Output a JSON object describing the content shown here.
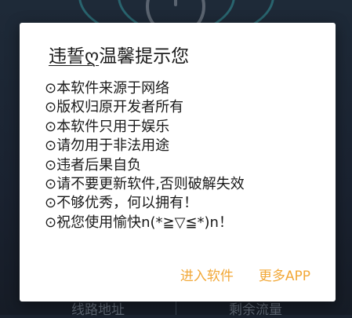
{
  "background": {
    "footer_labels": [
      "线路地址",
      "剩余流量"
    ]
  },
  "dialog": {
    "title_underlined": "违誓ღ",
    "title_rest": "温馨提示您",
    "messages": [
      "⊙本软件来源于网络",
      "⊙版权归原开发者所有",
      "⊙本软件只用于娱乐",
      "⊙请勿用于非法用途",
      "⊙违者后果自负",
      "⊙请不要更新软件,否则破解失效",
      "⊙不够优秀，何以拥有！",
      "⊙祝您使用愉快n(*≧▽≦*)n！"
    ],
    "actions": {
      "enter_label": "进入软件",
      "more_label": "更多APP"
    }
  },
  "colors": {
    "accent": "#f2a838",
    "overlay": "#1b2330",
    "dialog_bg": "#ffffff",
    "text": "#1a1a1a"
  }
}
